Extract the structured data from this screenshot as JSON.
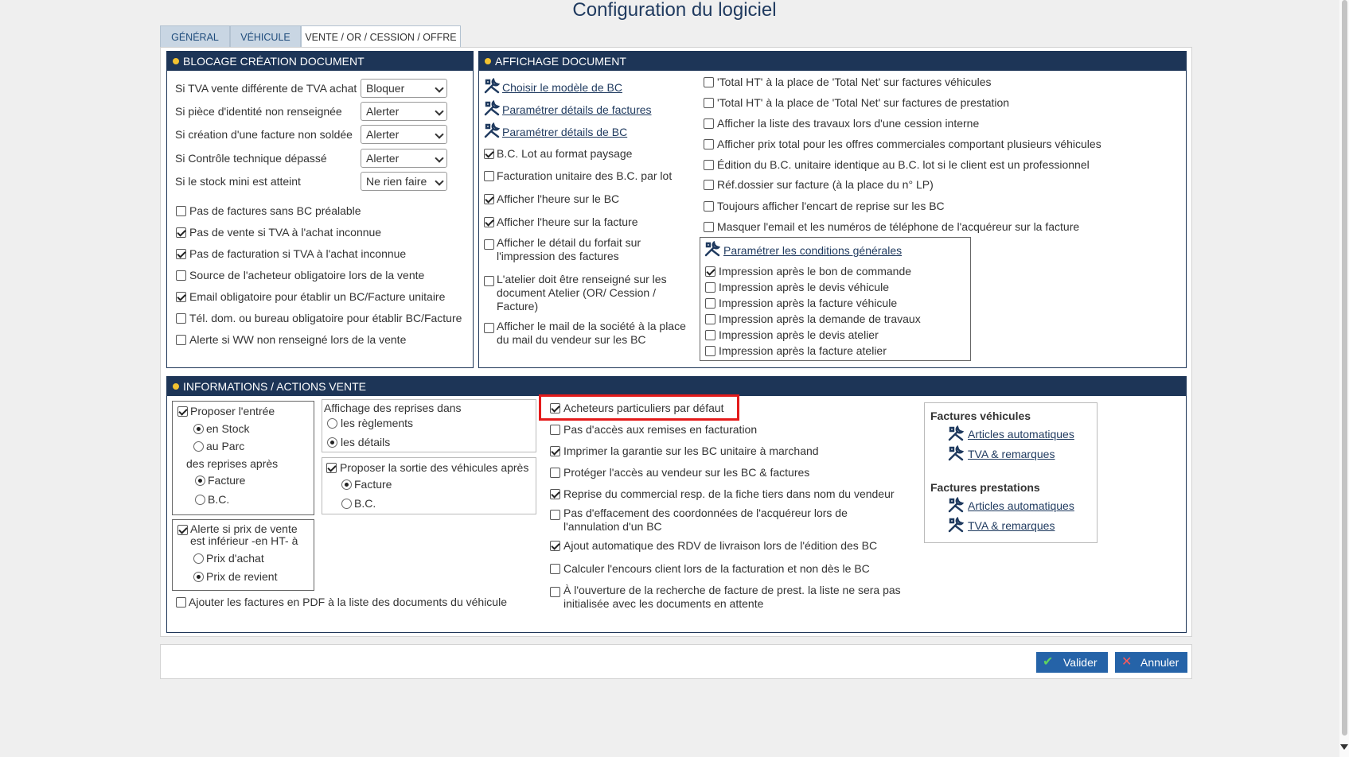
{
  "window": {
    "title": "Configuration du logiciel"
  },
  "tabs": [
    {
      "label": "GÉNÉRAL",
      "active": false
    },
    {
      "label": "VÉHICULE",
      "active": false
    },
    {
      "label": "VENTE / OR / CESSION / OFFRE",
      "active": true
    }
  ],
  "blocage": {
    "title": "BLOCAGE CRÉATION DOCUMENT",
    "rules": [
      {
        "label": "Si TVA vente différente de TVA achat",
        "value": "Bloquer"
      },
      {
        "label": "Si pièce d'identité non renseignée",
        "value": "Alerter"
      },
      {
        "label": "Si création d'une facture non soldée",
        "value": "Alerter"
      },
      {
        "label": "Si Contrôle technique dépassé",
        "value": "Alerter"
      },
      {
        "label": "Si le stock mini est atteint",
        "value": "Ne rien faire"
      }
    ],
    "checks": [
      {
        "label": "Pas de factures sans BC préalable",
        "checked": false
      },
      {
        "label": "Pas de vente si TVA à l'achat inconnue",
        "checked": true
      },
      {
        "label": "Pas de facturation si TVA à l'achat inconnue",
        "checked": true
      },
      {
        "label": "Source de l'acheteur obligatoire lors de la vente",
        "checked": false
      },
      {
        "label": "Email obligatoire pour établir un BC/Facture unitaire",
        "checked": true
      },
      {
        "label": "Tél. dom. ou bureau obligatoire pour établir BC/Facture",
        "checked": false
      },
      {
        "label": "Alerte si WW non renseigné lors de la vente",
        "checked": false
      }
    ]
  },
  "affichage": {
    "title": "AFFICHAGE DOCUMENT",
    "links": [
      {
        "label": "Choisir le modèle de BC",
        "icon": "tools-icon"
      },
      {
        "label": "Paramétrer détails de factures",
        "icon": "tools-icon"
      },
      {
        "label": "Paramétrer détails de BC",
        "icon": "tools-icon"
      }
    ],
    "left_checks": [
      {
        "label": "B.C. Lot au format paysage",
        "checked": true
      },
      {
        "label": "Facturation unitaire des B.C. par lot",
        "checked": false
      },
      {
        "label": "Afficher l'heure sur le BC",
        "checked": true
      },
      {
        "label": "Afficher l'heure sur la facture",
        "checked": true
      },
      {
        "label": "Afficher le détail du forfait sur l'impression des factures",
        "checked": false
      },
      {
        "label": "L'atelier doit être renseigné sur les document Atelier (OR/ Cession / Facture)",
        "checked": false
      },
      {
        "label": "Afficher le mail de la société à la place du mail du vendeur sur les BC",
        "checked": false
      }
    ],
    "right_checks": [
      {
        "label": "'Total HT' à la place de 'Total Net' sur factures véhicules",
        "checked": false
      },
      {
        "label": "'Total HT' à la place de 'Total Net' sur factures de prestation",
        "checked": false
      },
      {
        "label": "Afficher la liste des travaux lors d'une cession interne",
        "checked": false
      },
      {
        "label": "Afficher prix total pour les offres commerciales comportant plusieurs véhicules",
        "checked": false
      },
      {
        "label": "Édition du B.C. unitaire identique au B.C. lot si le client est un professionnel",
        "checked": false
      },
      {
        "label": "Réf.dossier sur facture (à la place du n° LP)",
        "checked": false
      },
      {
        "label": "Toujours afficher l'encart de reprise sur les BC",
        "checked": false
      },
      {
        "label": "Masquer l'email et les numéros de téléphone de l'acquéreur sur la facture",
        "checked": false
      }
    ],
    "conditions": {
      "link": "Paramétrer les conditions générales",
      "items": [
        {
          "label": "Impression après le bon de commande",
          "checked": true
        },
        {
          "label": "Impression après le devis véhicule",
          "checked": false
        },
        {
          "label": "Impression après la facture véhicule",
          "checked": false
        },
        {
          "label": "Impression après la demande de travaux",
          "checked": false
        },
        {
          "label": "Impression après le devis atelier",
          "checked": false
        },
        {
          "label": "Impression après la facture atelier",
          "checked": false
        }
      ]
    }
  },
  "infos": {
    "title": "INFORMATIONS / ACTIONS VENTE",
    "proposer_entree": {
      "label": "Proposer l'entrée",
      "checked": true,
      "options": [
        {
          "label": "en Stock",
          "selected": true
        },
        {
          "label": "au Parc",
          "selected": false
        }
      ],
      "sublabel": "des reprises après",
      "sub_options": [
        {
          "label": "Facture",
          "selected": true
        },
        {
          "label": "B.C.",
          "selected": false
        }
      ]
    },
    "affichage_reprises": {
      "label": "Affichage des reprises dans",
      "options": [
        {
          "label": "les règlements",
          "selected": false
        },
        {
          "label": "les détails",
          "selected": true
        }
      ]
    },
    "proposer_sortie": {
      "label": "Proposer la sortie des véhicules après",
      "checked": true,
      "options": [
        {
          "label": "Facture",
          "selected": true
        },
        {
          "label": "B.C.",
          "selected": false
        }
      ]
    },
    "alerte_prix": {
      "label": "Alerte si prix de vente est inférieur -en HT- à",
      "checked": true,
      "options": [
        {
          "label": "Prix d'achat",
          "selected": false
        },
        {
          "label": "Prix de revient",
          "selected": true
        }
      ]
    },
    "pdf_check": {
      "label": "Ajouter les factures en PDF à la liste des documents du véhicule",
      "checked": false
    },
    "middle_checks": [
      {
        "label": "Acheteurs particuliers par défaut",
        "checked": true
      },
      {
        "label": "Pas d'accès aux remises en facturation",
        "checked": false
      },
      {
        "label": "Imprimer la garantie sur les BC unitaire à marchand",
        "checked": true
      },
      {
        "label": "Protéger l'accès au vendeur sur les BC & factures",
        "checked": false
      },
      {
        "label": "Reprise du commercial resp. de la fiche tiers dans nom du vendeur",
        "checked": true
      },
      {
        "label": "Pas d'effacement des coordonnées de l'acquéreur lors de l'annulation d'un BC",
        "checked": false
      },
      {
        "label": "Ajout automatique des RDV de livraison lors de l'édition des BC",
        "checked": true
      },
      {
        "label": "Calculer l'encours client lors de la facturation et non dès le BC",
        "checked": false
      },
      {
        "label": "À l'ouverture de la recherche de facture de prest. la liste ne sera pas initialisée avec les documents en attente",
        "checked": false
      }
    ],
    "factures_vehicules": {
      "title": "Factures véhicules",
      "links": [
        "Articles automatiques",
        "TVA & remarques"
      ]
    },
    "factures_prestations": {
      "title": "Factures prestations",
      "links": [
        "Articles automatiques",
        "TVA & remarques"
      ]
    }
  },
  "footer": {
    "valider": "Valider",
    "annuler": "Annuler"
  },
  "colors": {
    "header": "#1d3557",
    "accent_dot": "#f2c230",
    "button": "#2563a8",
    "highlight": "#e41b1b"
  }
}
